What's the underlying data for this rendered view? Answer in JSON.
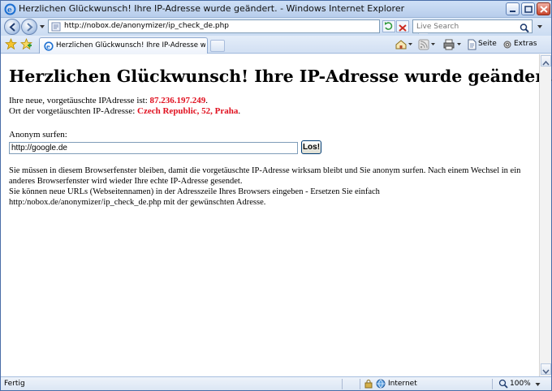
{
  "window": {
    "title": "Herzlichen Glückwunsch! Ihre IP-Adresse wurde geändert. - Windows Internet Explorer"
  },
  "address_bar": {
    "url": "http://nobox.de/anonymizer/ip_check_de.php"
  },
  "search": {
    "placeholder": "Live Search"
  },
  "tab": {
    "label": "Herzlichen Glückwunsch! Ihre IP-Adresse wurde geän..."
  },
  "command_bar": {
    "page_label": "Seite",
    "extras_label": "Extras"
  },
  "page": {
    "heading": "Herzlichen Glückwunsch! Ihre IP-Adresse wurde geändert.",
    "ip_line_prefix": "Ihre neue, vorgetäuschte IPAdresse ist: ",
    "ip_value": "87.236.197.249",
    "ip_line_suffix": ".",
    "location_prefix": "Ort der vorgetäuschten IP-Adresse: ",
    "location_value": "Czech Republic, 52, Praha",
    "location_suffix": ".",
    "anon_label": "Anonym surfen:",
    "url_input_value": "http://google.de",
    "submit_label": "Los!",
    "info_line1": "Sie müssen in diesem Browserfenster bleiben, damit die vorgetäuschte IP-Adresse wirksam bleibt und Sie anonym surfen. Nach einem Wechsel in ein anderes Browserfenster wird wieder Ihre echte IP-Adresse gesendet.",
    "info_line2": "Sie können neue URLs (Webseitennamen) in der Adresszeile Ihres Browsers eingeben - Ersetzen Sie einfach http:/nobox.de/anonymizer/ip_check_de.php mit der gewünschten Adresse.",
    "highlight_color": "#e0101f"
  },
  "status_bar": {
    "status": "Fertig",
    "zone": "Internet",
    "zoom": "100%"
  }
}
